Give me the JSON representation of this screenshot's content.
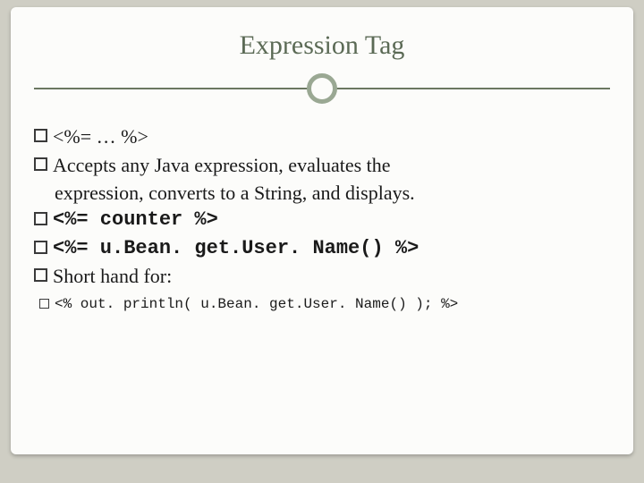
{
  "title": "Expression Tag",
  "items": {
    "b1": "<%= … %>",
    "b2": "Accepts any Java expression, evaluates the",
    "b2_cont": "expression, converts to a String, and displays.",
    "b3": "<%= counter %>",
    "b4": "<%= u.Bean. get.User. Name() %>",
    "b5": "Short hand for:",
    "sub1": "<% out. println( u.Bean. get.User. Name() ); %>"
  }
}
